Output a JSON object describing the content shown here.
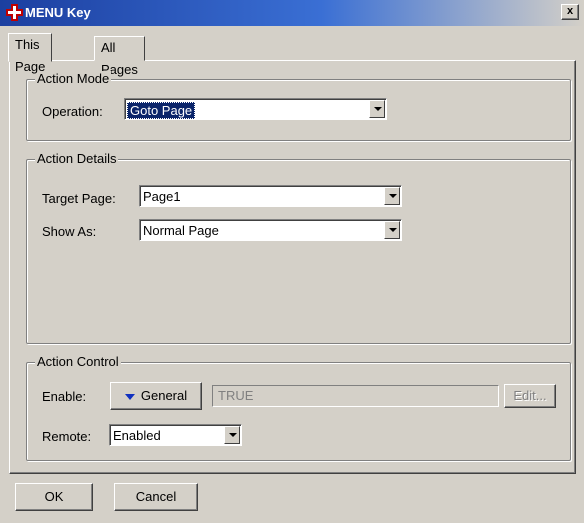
{
  "window": {
    "title": "MENU Key",
    "close_label": "x"
  },
  "tabs": [
    "This Page",
    "All Pages"
  ],
  "action_mode": {
    "title": "Action Mode",
    "operation_label": "Operation:",
    "operation_value": "Goto Page"
  },
  "action_details": {
    "title": "Action Details",
    "target_page_label": "Target Page:",
    "target_page_value": "Page1",
    "show_as_label": "Show As:",
    "show_as_value": "Normal Page"
  },
  "action_control": {
    "title": "Action Control",
    "enable_label": "Enable:",
    "general_button": "General",
    "enable_expression": "TRUE",
    "edit_button": "Edit...",
    "remote_label": "Remote:",
    "remote_value": "Enabled"
  },
  "footer": {
    "ok_label": "OK",
    "cancel_label": "Cancel"
  },
  "colors": {
    "titlebar_start": "#1c3fa0",
    "selection": "#0a246a",
    "face": "#d4d0c8"
  }
}
